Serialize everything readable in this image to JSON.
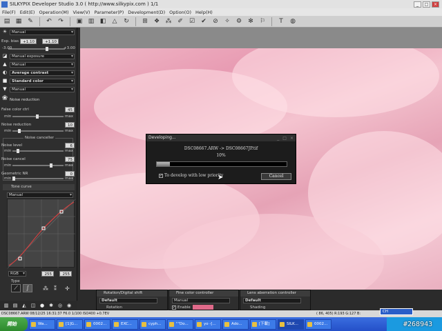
{
  "window": {
    "title": "SILKYPIX Developer Studio 3.0 ( http://www.silkypix.com )   1/1",
    "min": "_",
    "max": "□",
    "close": "×"
  },
  "menu": [
    "File(F)",
    "Edit(E)",
    "Operation(M)",
    "View(V)",
    "Parameter(P)",
    "Development(D)",
    "Option(O)",
    "Help(H)"
  ],
  "left": {
    "wb_preset": "Manual",
    "exp_bias_label": "Exp. bias",
    "exp_bias_value": "+1.10",
    "exp_bias_value2": "+1.10",
    "exp_min": "-3.00",
    "exp_max": "+3.00",
    "exposure_mode": "Manual exposure",
    "tone": "Manual",
    "contrast": "Average contrast",
    "color": "Standard color",
    "sharpness": "Manual",
    "noise_reduction_title": "Noise reduction",
    "false_color_label": "False color ctrl",
    "false_color_value": "45",
    "nr_label": "Noise reduction",
    "nr_value": "10",
    "canceller_title": "Noise canceller",
    "noise_level_label": "Noise level",
    "noise_level_value": "6",
    "noise_cancel_label": "Noise cancel",
    "noise_cancel_value": "75",
    "geometric_label": "Geometric NR",
    "geometric_value": "0",
    "min": "min",
    "max": "max",
    "tone_curve_title": "Tone curve",
    "tone_curve_mode": "Manual",
    "channel": "RGB",
    "ch_v1": "255",
    "ch_v2": "255",
    "type_label": "Type"
  },
  "dialog": {
    "title": "Developing...",
    "file": "DSC08667.ARW -> DSC08667JP.tif",
    "percent": "10%",
    "progress": 0.1,
    "checkbox": "To develop with low priority",
    "cancel": "Cancel"
  },
  "bottom_panels": [
    {
      "title": "Rotation/Digital shift",
      "preset": "Default",
      "sub": "Rotation"
    },
    {
      "title": "Fine color controller",
      "preset": "Manual",
      "sub": "Enable",
      "sub2": "Hue"
    },
    {
      "title": "Lens aberration controller",
      "preset": "Default",
      "sub": "Shading",
      "sub2": "Angle"
    }
  ],
  "status": {
    "left": "DSC08667.ARW 08/12/25 16:31:37 F6.0 1/100 ISO400 +0.7EV",
    "right": "(   86, 405)  R:193 G:127 B:"
  },
  "taskbar": {
    "start": "開始",
    "tasks": [
      "Wa...",
      "[1]G...",
      "0002...",
      "EXC...",
      "cyph...",
      "\"\"Do...",
      "yo -[...",
      "Ado...",
      "[下載]",
      "SILK...",
      "0002..."
    ]
  },
  "langbar": "CH",
  "watermark": "#268943"
}
